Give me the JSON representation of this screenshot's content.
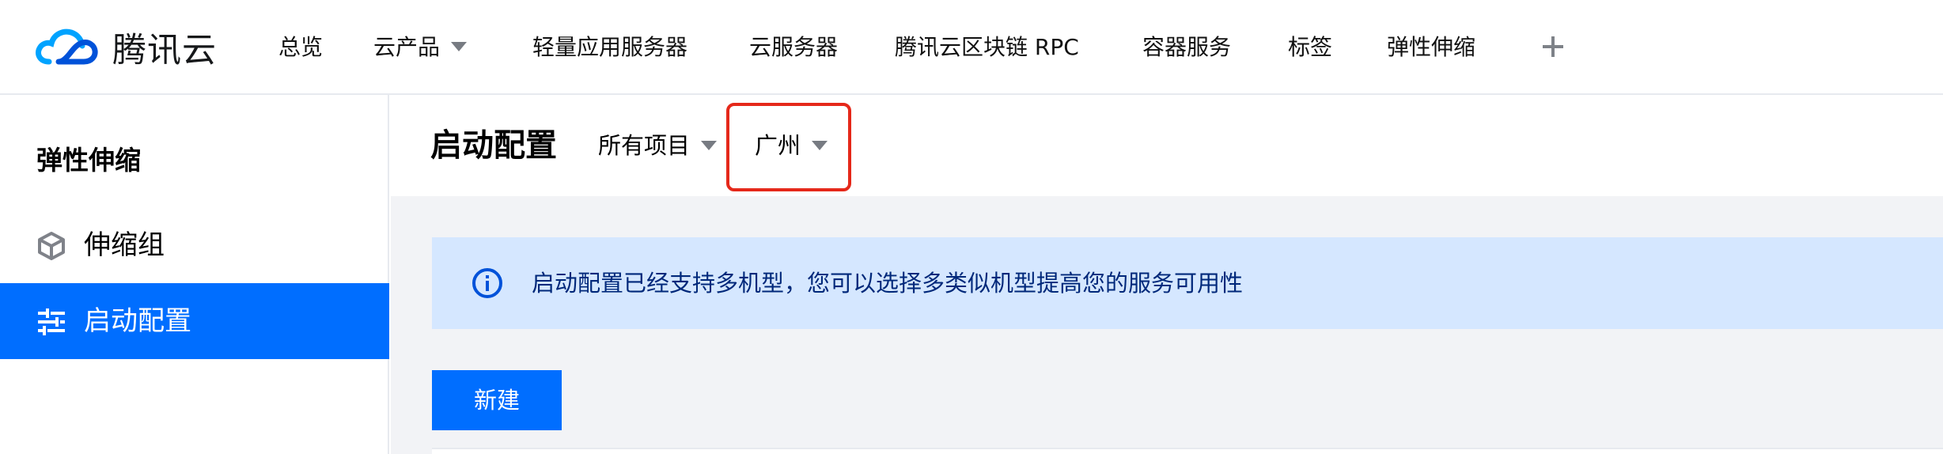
{
  "brand": {
    "name": "腾讯云",
    "logo_colors": [
      "#00a3ff",
      "#0052d9"
    ]
  },
  "topnav": {
    "items": [
      {
        "label": "总览"
      },
      {
        "label": "云产品"
      },
      {
        "label": "轻量应用服务器"
      },
      {
        "label": "云服务器"
      },
      {
        "label": "腾讯云区块链 RPC"
      },
      {
        "label": "容器服务"
      },
      {
        "label": "标签"
      },
      {
        "label": "弹性伸缩"
      }
    ],
    "add_icon": "plus-icon"
  },
  "sidebar": {
    "title": "弹性伸缩",
    "items": [
      {
        "label": "伸缩组",
        "icon": "cube-icon",
        "active": false
      },
      {
        "label": "启动配置",
        "icon": "sliders-icon",
        "active": true
      }
    ]
  },
  "page": {
    "title": "启动配置",
    "project_select": "所有项目",
    "region_select": "广州"
  },
  "notice": {
    "icon": "info-icon",
    "text": "启动配置已经支持多机型，您可以选择多类似机型提高您的服务可用性"
  },
  "actions": {
    "new_label": "新建"
  },
  "colors": {
    "primary": "#006eff",
    "notice_bg": "#d5e7ff",
    "notice_text": "#00287a",
    "highlight": "#e5281a",
    "page_bg": "#f2f3f6"
  }
}
